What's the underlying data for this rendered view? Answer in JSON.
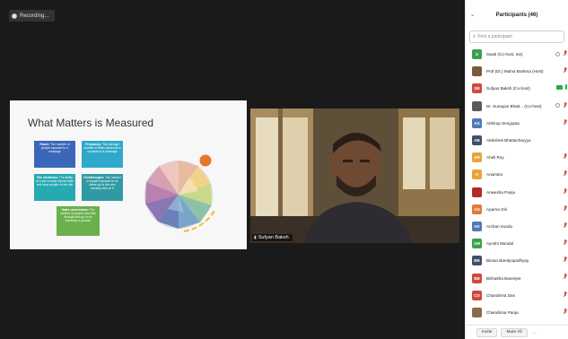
{
  "recording": {
    "label": "Recording..."
  },
  "slide": {
    "title": "What Matters is Measured",
    "boxes": {
      "reach": {
        "title": "Reach:",
        "text": "The number of people exposed to a message"
      },
      "frequency": {
        "title": "Frequency:",
        "text": "The average number of times someone is exposed to a message"
      },
      "site": {
        "title": "Site stickiness:",
        "text": "The ability of a site to draw repeat visits and keep people on the site"
      },
      "click": {
        "title": "Clickthroughs:",
        "text": "The number of people exposed to an online ad or link who actually click on it"
      },
      "sales": {
        "title": "Sales conversions:",
        "text": "The number of people who click through who go on to purchase a product"
      }
    }
  },
  "video": {
    "speaker_name": "Sufyan Baksh"
  },
  "panel": {
    "title": "Participants (46)",
    "search_placeholder": "Find a participant",
    "participants": [
      {
        "name": "Swati (Co-host, me)",
        "initials": "S",
        "color": "#3aa04b",
        "icons": [
          "raise",
          "mic-muted"
        ]
      },
      {
        "name": "Prof (Dr.) Mahul Brahma (Host)",
        "initials": "",
        "color": "#7a5a3a",
        "icons": [
          "mic-muted"
        ]
      },
      {
        "name": "Sufyan Baksh (Co-host)",
        "initials": "SB",
        "color": "#d0493f",
        "icons": [
          "cam-green",
          "mic-green"
        ]
      },
      {
        "name": "Dr. Sunayan Bhatt... (Co-host)",
        "initials": "",
        "color": "#5b5b5b",
        "icons": [
          "raise",
          "mic-muted"
        ]
      },
      {
        "name": "Abhirup Sengupta",
        "initials": "AS",
        "color": "#4f79b6",
        "icons": [
          "mic-muted"
        ]
      },
      {
        "name": "Abhishek Bhattacharyya",
        "initials": "AB",
        "color": "#3f4f6a",
        "icons": []
      },
      {
        "name": "Aheli Roy",
        "initials": "AR",
        "color": "#e8a33a",
        "icons": [
          "mic-muted"
        ]
      },
      {
        "name": "Anamitra",
        "initials": "A",
        "color": "#e8a33a",
        "icons": [
          "mic-muted"
        ]
      },
      {
        "name": "Anwesha Panja",
        "initials": "",
        "color": "#b02a2a",
        "icons": [
          "mic-muted"
        ]
      },
      {
        "name": "Aparna Giri",
        "initials": "AG",
        "color": "#e07b39",
        "icons": [
          "mic-muted"
        ]
      },
      {
        "name": "Archan Kundu",
        "initials": "AK",
        "color": "#4f79b6",
        "icons": [
          "mic-muted"
        ]
      },
      {
        "name": "Ayoshi Mondal",
        "initials": "AM",
        "color": "#3aa04b",
        "icons": [
          "mic-muted"
        ]
      },
      {
        "name": "Biman Bandyopadhyay",
        "initials": "BB",
        "color": "#3f4f6a",
        "icons": [
          "mic-muted"
        ]
      },
      {
        "name": "Bishakha Banerjee",
        "initials": "BB",
        "color": "#d0493f",
        "icons": [
          "mic-muted"
        ]
      },
      {
        "name": "Chandrima Das",
        "initials": "CD",
        "color": "#d0493f",
        "icons": [
          "mic-muted"
        ]
      },
      {
        "name": "Chandrima Panja",
        "initials": "",
        "color": "#8a6a4a",
        "icons": [
          "mic-muted"
        ]
      }
    ],
    "footer": {
      "invite_label": "Invite",
      "mute_all_label": "Mute All",
      "more_label": "..."
    }
  }
}
